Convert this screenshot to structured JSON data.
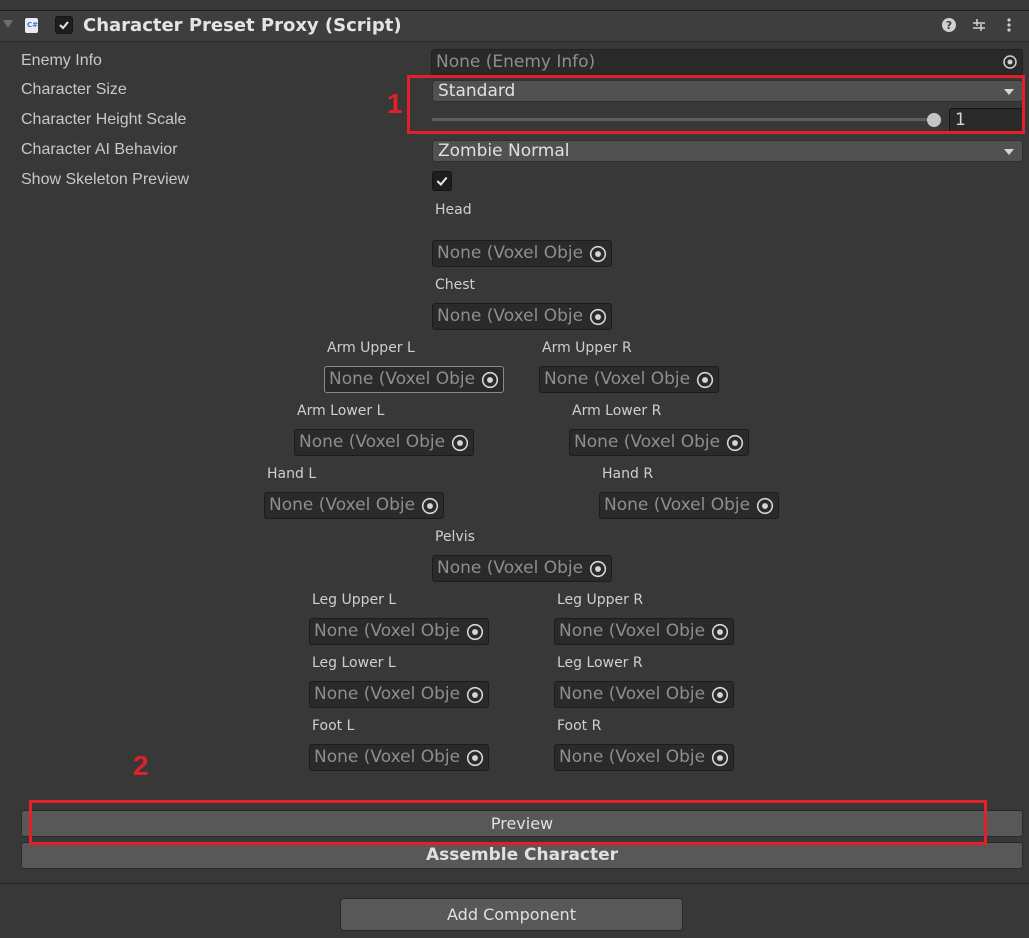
{
  "header": {
    "title": "Character Preset Proxy (Script)",
    "script_icon_text": "C#",
    "enabled": true
  },
  "properties": {
    "enemy_info": {
      "label": "Enemy Info",
      "value": "None (Enemy Info)"
    },
    "character_size": {
      "label": "Character Size",
      "value": "Standard"
    },
    "character_height_scale": {
      "label": "Character Height Scale",
      "value": "1",
      "slider_fraction": 1.0
    },
    "character_ai_behavior": {
      "label": "Character AI Behavior",
      "value": "Zombie Normal"
    },
    "show_skeleton_preview": {
      "label": "Show Skeleton Preview",
      "checked": true
    }
  },
  "slots": [
    {
      "label": "Head",
      "value": "None (Voxel Obje"
    },
    {
      "label": "Chest",
      "value": "None (Voxel Obje"
    },
    {
      "label": "Arm Upper L",
      "value": "None (Voxel Obje"
    },
    {
      "label": "Arm Upper R",
      "value": "None (Voxel Obje"
    },
    {
      "label": "Arm Lower L",
      "value": "None (Voxel Obje"
    },
    {
      "label": "Arm Lower R",
      "value": "None (Voxel Obje"
    },
    {
      "label": "Hand L",
      "value": "None (Voxel Obje"
    },
    {
      "label": "Hand R",
      "value": "None (Voxel Obje"
    },
    {
      "label": "Pelvis",
      "value": "None (Voxel Obje"
    },
    {
      "label": "Leg Upper L",
      "value": "None (Voxel Obje"
    },
    {
      "label": "Leg Upper R",
      "value": "None (Voxel Obje"
    },
    {
      "label": "Leg Lower L",
      "value": "None (Voxel Obje"
    },
    {
      "label": "Leg Lower R",
      "value": "None (Voxel Obje"
    },
    {
      "label": "Foot L",
      "value": "None (Voxel Obje"
    },
    {
      "label": "Foot R",
      "value": "None (Voxel Obje"
    }
  ],
  "buttons": {
    "preview": "Preview",
    "assemble": "Assemble Character",
    "add_component": "Add Component"
  },
  "annotations": {
    "first": "1",
    "second": "2"
  },
  "icons": [
    "fold-arrow-icon",
    "script-icon",
    "help-icon",
    "presets-icon",
    "kebab-menu-icon",
    "object-picker-icon",
    "dropdown-arrow-icon",
    "checkmark-icon"
  ],
  "colors": {
    "annotation_red": "#e0202a",
    "panel_bg": "#383838",
    "field_bg": "#2a2a2a"
  }
}
